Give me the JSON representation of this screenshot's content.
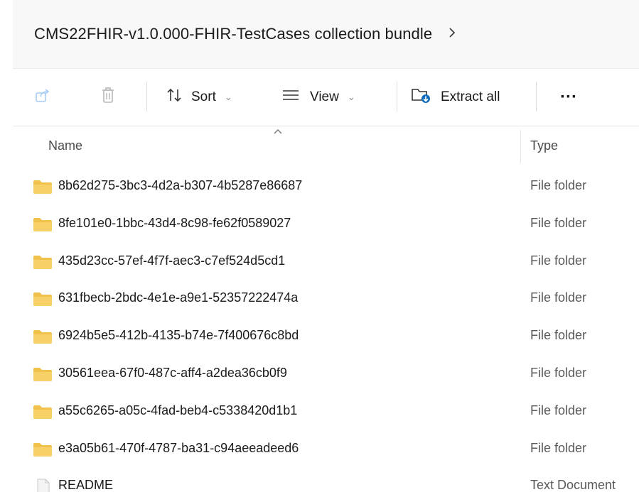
{
  "breadcrumb": {
    "current": "CMS22FHIR-v1.0.000-FHIR-TestCases collection bundle",
    "chevron_icon": "chevron-right-icon"
  },
  "toolbar": {
    "share_icon": "share-icon",
    "delete_icon": "trash-icon",
    "sort_label": "Sort",
    "view_label": "View",
    "extract_label": "Extract all",
    "more_label": "···",
    "accent_color": "#0f6cbd",
    "folder_color": "#f0c14b"
  },
  "columns": {
    "name": "Name",
    "type": "Type"
  },
  "files": [
    {
      "name": "8b62d275-3bc3-4d2a-b307-4b5287e86687",
      "type": "File folder",
      "icon": "folder-icon"
    },
    {
      "name": "8fe101e0-1bbc-43d4-8c98-fe62f0589027",
      "type": "File folder",
      "icon": "folder-icon"
    },
    {
      "name": "435d23cc-57ef-4f7f-aec3-c7ef524d5cd1",
      "type": "File folder",
      "icon": "folder-icon"
    },
    {
      "name": "631fbecb-2bdc-4e1e-a9e1-52357222474a",
      "type": "File folder",
      "icon": "folder-icon"
    },
    {
      "name": "6924b5e5-412b-4135-b74e-7f400676c8bd",
      "type": "File folder",
      "icon": "folder-icon"
    },
    {
      "name": "30561eea-67f0-487c-aff4-a2dea36cb0f9",
      "type": "File folder",
      "icon": "folder-icon"
    },
    {
      "name": "a55c6265-a05c-4fad-beb4-c5338420d1b1",
      "type": "File folder",
      "icon": "folder-icon"
    },
    {
      "name": "e3a05b61-470f-4787-ba31-c94aeeadeed6",
      "type": "File folder",
      "icon": "folder-icon"
    },
    {
      "name": "README",
      "type": "Text Document",
      "icon": "text-file-icon"
    }
  ]
}
